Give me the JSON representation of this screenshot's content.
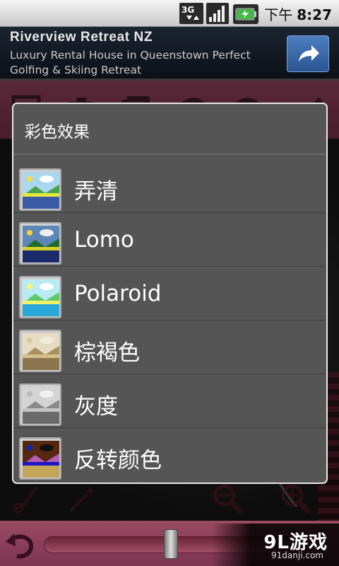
{
  "status_bar": {
    "network_label": "3G",
    "time_prefix": "下午",
    "time": "8:27",
    "icons": [
      "3g-data-icon",
      "signal-strength-icon",
      "battery-charging-icon"
    ]
  },
  "ad": {
    "title": "Riverview Retreat NZ",
    "description": "Luxury Rental House in Queenstown Perfect Golfing & Skiing Retreat",
    "action_icon": "share-arrow-icon"
  },
  "background_app": {
    "toolbar_icons": [
      "frame-icon",
      "camera-icon",
      "gallery-icon",
      "undo-icon",
      "redo-icon",
      "check-icon"
    ],
    "bottom_icons": [
      "brush-icon",
      "magic-wand-icon",
      "zoom-out-icon",
      "zoom-in-icon"
    ],
    "slider_level": 0.5
  },
  "watermark": {
    "logo": "9L游戏",
    "url": "91danji.com"
  },
  "dialog": {
    "title": "彩色效果",
    "items": [
      {
        "label": "弄清",
        "icon": "landscape-clear-icon"
      },
      {
        "label": "Lomo",
        "icon": "landscape-lomo-icon"
      },
      {
        "label": "Polaroid",
        "icon": "landscape-polaroid-icon"
      },
      {
        "label": "棕褐色",
        "icon": "landscape-sepia-icon"
      },
      {
        "label": "灰度",
        "icon": "landscape-grayscale-icon"
      },
      {
        "label": "反转颜色",
        "icon": "landscape-negative-icon"
      }
    ]
  },
  "colors": {
    "dialog_bg": "#555556",
    "toolbar_bg": "#8a3e57",
    "ad_bg": "#1b2431"
  }
}
